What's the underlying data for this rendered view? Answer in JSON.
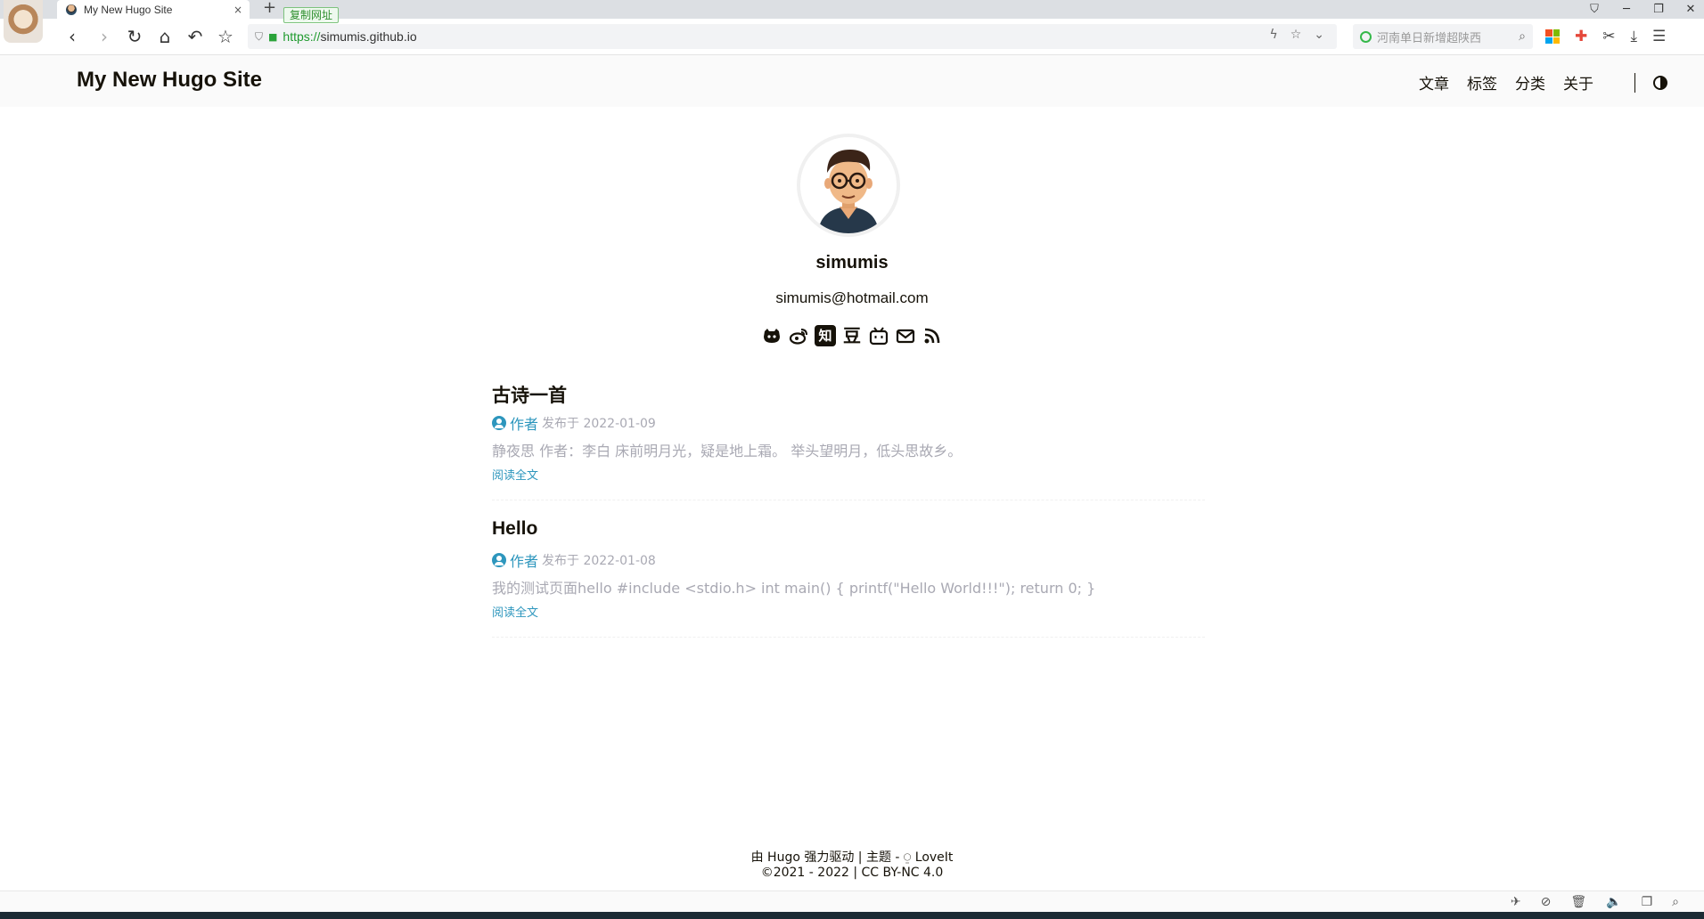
{
  "browser": {
    "tab_title": "My New Hugo Site",
    "tab_close": "×",
    "new_tab": "+",
    "copy_url_label": "复制网址",
    "url_scheme": "https://",
    "url_host": "simumis.github.io",
    "search_placeholder": "河南单日新增超陕西",
    "window_controls": [
      "⛉",
      "─",
      "❐",
      "✕"
    ],
    "icons": {
      "back": "‹",
      "forward": "›",
      "reload": "↻",
      "home": "⌂",
      "undo": "↶",
      "star": "☆",
      "lightning": "ϟ",
      "chevron": "⌄",
      "search": "⌕",
      "scissors": "✂",
      "download": "⤓",
      "menu": "☰"
    },
    "status_icons": [
      "✈",
      "⊘",
      "🗑",
      "🔈",
      "❐",
      "⌕"
    ]
  },
  "site": {
    "title": "My New Hugo Site",
    "menu": [
      "文章",
      "标签",
      "分类",
      "关于"
    ]
  },
  "profile": {
    "name": "simumis",
    "email": "simumis@hotmail.com",
    "social_icons": [
      "github-icon",
      "weibo-icon",
      "zhihu-icon",
      "douban-icon",
      "bilibili-icon",
      "email-icon",
      "rss-icon"
    ],
    "zhihu_glyph": "知",
    "douban_glyph": "豆"
  },
  "posts": [
    {
      "title": "古诗一首",
      "author": "作者",
      "date": "发布于 2022-01-09",
      "summary": "静夜思 作者：李白 床前明月光，疑是地上霜。 举头望明月，低头思故乡。",
      "read_more": "阅读全文"
    },
    {
      "title": "Hello",
      "author": "作者",
      "date": "发布于 2022-01-08",
      "summary": "我的测试页面hello #include <stdio.h> int main() { printf(\"Hello World!!!\"); return 0; }",
      "read_more": "阅读全文"
    }
  ],
  "footer": {
    "powered": "由 Hugo 强力驱动 | 主题 - ⍜ LoveIt",
    "copyright": "©2021 - 2022 | CC BY-NC 4.0"
  },
  "colors": {
    "accent": "#2d96bd",
    "text": "#161209",
    "muted": "#a9a9b3",
    "header_bg": "#fafafa"
  }
}
